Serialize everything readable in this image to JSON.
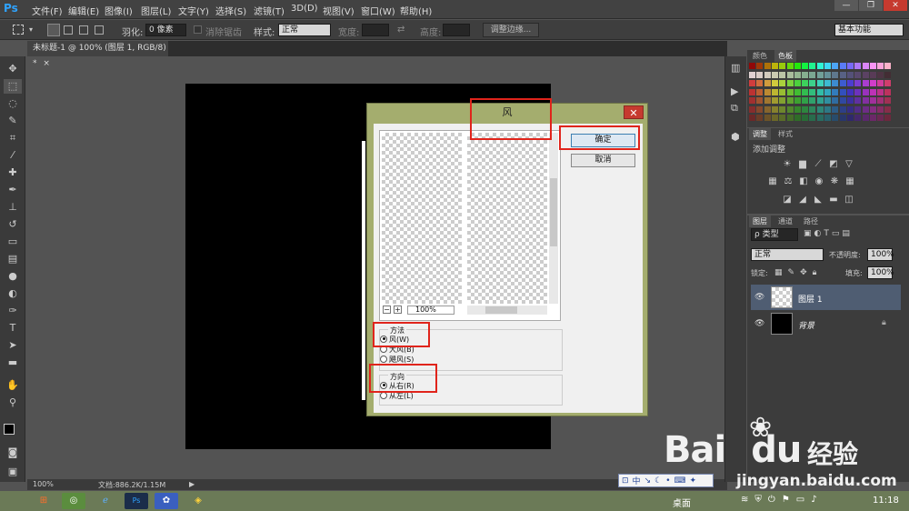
{
  "menubar": {
    "logo": "Ps",
    "items": [
      "文件(F)",
      "编辑(E)",
      "图像(I)",
      "图层(L)",
      "文字(Y)",
      "选择(S)",
      "滤镜(T)",
      "3D(D)",
      "视图(V)",
      "窗口(W)",
      "帮助(H)"
    ],
    "minimize": "—",
    "restore": "❐",
    "close": "✕"
  },
  "options": {
    "feather_label": "羽化:",
    "feather_value": "0 像素",
    "antialias_label": "消除锯齿",
    "style_label": "样式:",
    "style_value": "正常",
    "width_label": "宽度:",
    "height_label": "高度:",
    "refine_edge": "调整边缘...",
    "workspace": "基本功能"
  },
  "document": {
    "tab_title": "未标题-1 @ 100% (图层 1, RGB/8) *",
    "tab_close": "×"
  },
  "status": {
    "zoom": "100%",
    "doc_info": "文档:886.2K/1.15M"
  },
  "panels": {
    "color_tab": "颜色",
    "swatches_tab": "色板",
    "adjust_tab": "调整",
    "styles_tab": "样式",
    "add_adjust": "添加调整",
    "layers_tab": "图层",
    "channels_tab": "通道",
    "paths_tab": "路径",
    "kind_filter": "ρ 类型",
    "blend_mode": "正常",
    "opacity_label": "不透明度:",
    "opacity_value": "100%",
    "lock_label": "锁定:",
    "fill_label": "填充:",
    "fill_value": "100%",
    "layers": [
      {
        "name": "图层 1",
        "selected": true
      },
      {
        "name": "背景",
        "selected": false
      }
    ]
  },
  "dialog": {
    "title": "风",
    "ok_button": "确定",
    "cancel_button": "取消",
    "zoom_value": "100%",
    "method_label": "方法",
    "method_options": [
      {
        "label": "风(W)",
        "selected": true
      },
      {
        "label": "大风(B)",
        "selected": false
      },
      {
        "label": "飓风(S)",
        "selected": false
      }
    ],
    "direction_label": "方向",
    "direction_options": [
      {
        "label": "从右(R)",
        "selected": true
      },
      {
        "label": "从左(L)",
        "selected": false
      }
    ]
  },
  "taskbar": {
    "desktop_label": "桌面",
    "time": "11:18"
  },
  "watermark": {
    "brand": "Bai",
    "brand2": "du",
    "cn": "经验",
    "url": "jingyan.baidu.com"
  },
  "colors": {
    "accent": "#2fa3ff",
    "dialog_frame": "#a4ad6e",
    "highlight_box": "#e0241b"
  }
}
